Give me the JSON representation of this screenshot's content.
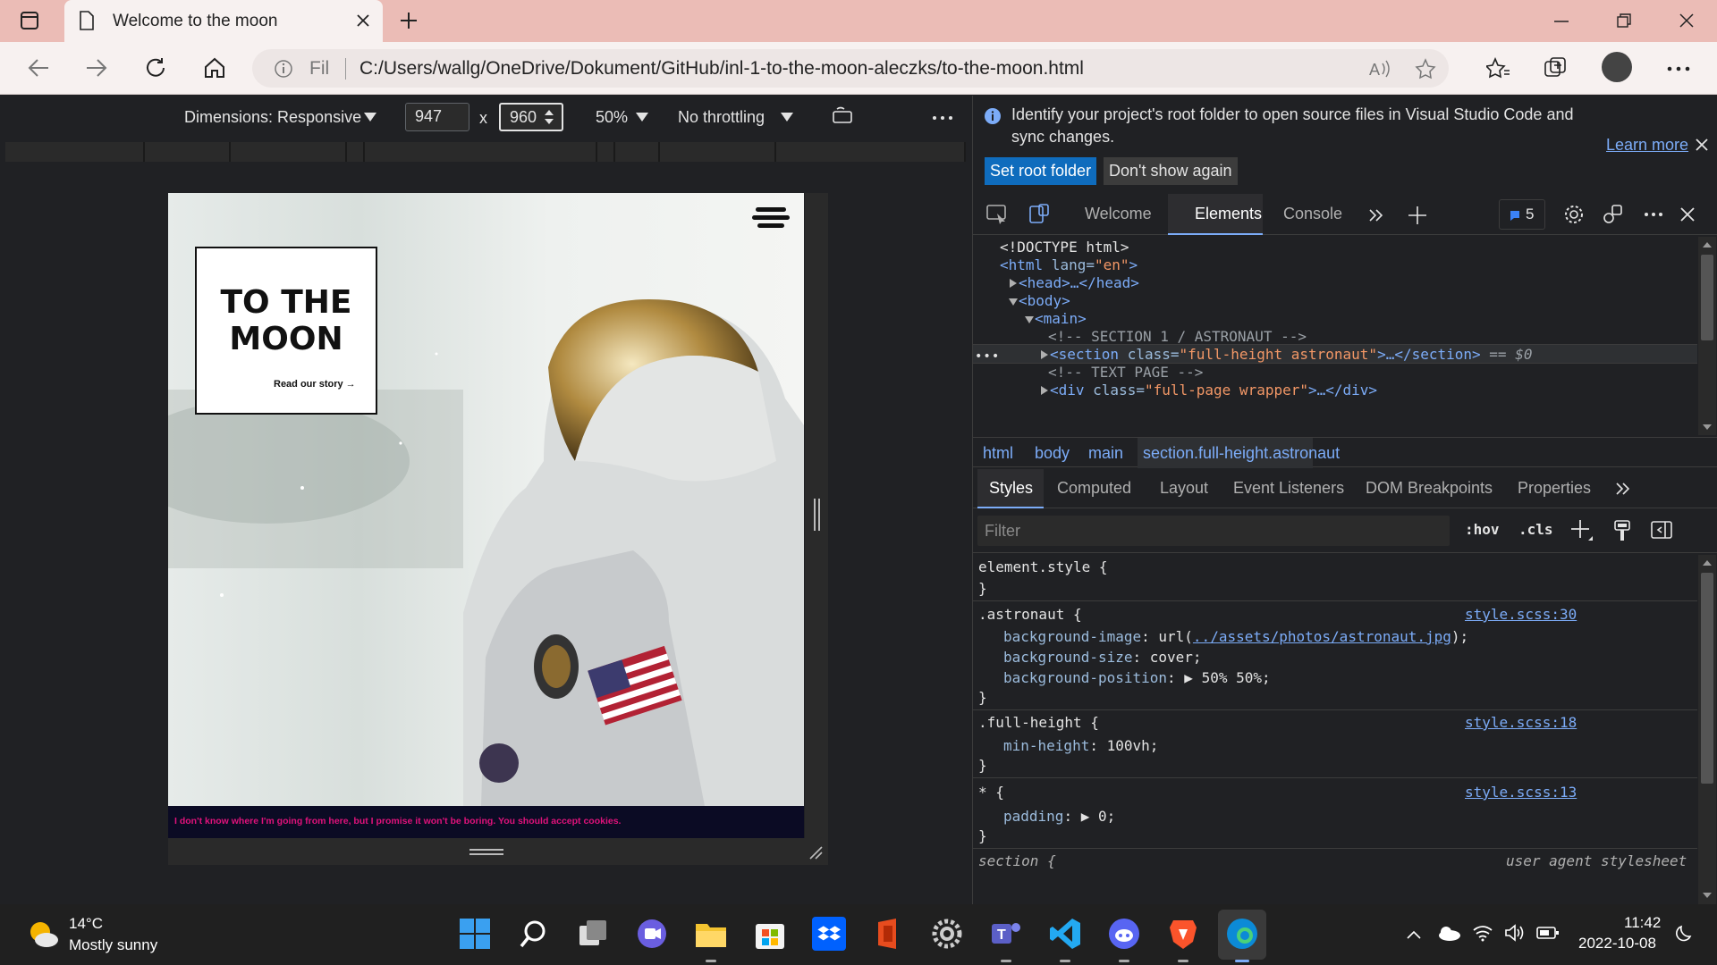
{
  "browser": {
    "tab_title": "Welcome to the moon",
    "url_prefix": "Fil",
    "url": "C:/Users/wallg/OneDrive/Dokument/GitHub/inl-1-to-the-moon-aleczks/to-the-moon.html"
  },
  "device_toolbar": {
    "dimensions": "Dimensions: Responsive",
    "width": "947",
    "times": "x",
    "height": "960",
    "zoom": "50%",
    "throttling": "No throttling"
  },
  "page": {
    "title_line1": "TO THE",
    "title_line2": "MOON",
    "read_story": "Read our story →",
    "footer": "I don't know where I'm going from here, but I promise it won't be boring. You should accept cookies."
  },
  "devtools": {
    "info_text_line1": "Identify your project's root folder to open source files in Visual Studio Code and",
    "info_text_line2": "sync changes.",
    "learn_more": "Learn more",
    "set_root": "Set root folder",
    "dont_show": "Don't show again",
    "tabs": [
      "Welcome",
      "Elements",
      "Console"
    ],
    "issues_count": "5",
    "dom": {
      "doctype": "<!DOCTYPE html>",
      "html_open": "<html",
      "html_attr": " lang=",
      "html_val": "\"en\"",
      "html_close": ">",
      "head": "<head>…</head>",
      "body": "<body>",
      "main": "<main>",
      "comment1": "<!-- SECTION 1 / ASTRONAUT -->",
      "section_open": "<section",
      "section_attr": " class=",
      "section_val": "\"full-height astronaut\"",
      "section_close": ">…</section>",
      "section_eq": " == $0",
      "comment2": "<!-- TEXT PAGE -->",
      "div_open": "<div",
      "div_attr": " class=",
      "div_val": "\"full-page wrapper\"",
      "div_close": ">…</div>"
    },
    "breadcrumbs": [
      "html",
      "body",
      "main",
      "section.full-height.astronaut"
    ],
    "subtabs": [
      "Styles",
      "Computed",
      "Layout",
      "Event Listeners",
      "DOM Breakpoints",
      "Properties"
    ],
    "filter_placeholder": "Filter",
    "hov": ":hov",
    "cls": ".cls",
    "styles": {
      "element_style": "element.style {",
      "close": "}",
      "astronaut_sel": ".astronaut {",
      "astronaut_src": "style.scss:30",
      "bg_image_prop": "background-image",
      "bg_image_pre": ": url(",
      "bg_image_url": "../assets/photos/astronaut.jpg",
      "bg_image_post": ");",
      "bg_size_prop": "background-size",
      "bg_size_val": ": cover;",
      "bg_pos_prop": "background-position",
      "bg_pos_val": "50% 50%;",
      "fh_sel": ".full-height {",
      "fh_src": "style.scss:18",
      "min_height_prop": "min-height",
      "min_height_val": ": 100vh;",
      "star_sel": "* {",
      "star_src": "style.scss:13",
      "padding_prop": "padding",
      "padding_val": "0;",
      "section_sel": "section {",
      "ua": "user agent stylesheet"
    }
  },
  "taskbar": {
    "temp": "14°C",
    "weather": "Mostly sunny",
    "time": "11:42",
    "date": "2022-10-08"
  }
}
